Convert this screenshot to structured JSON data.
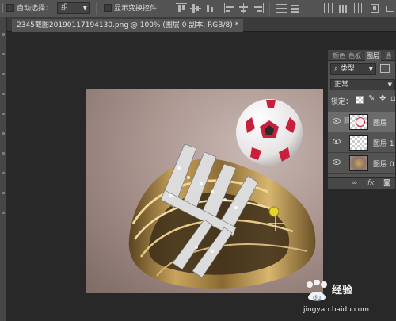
{
  "options_bar": {
    "auto_select_label": "自动选择：",
    "auto_select_value": "组",
    "show_transform_label": "显示变换控件"
  },
  "document": {
    "tab_title": "2345截图20190117194130.png @ 100% (图层 0 副本, RGB/8) *"
  },
  "layers_panel": {
    "tabs": [
      "颜色",
      "色板",
      "图层",
      "通"
    ],
    "active_tab": "图层",
    "filter_kind": "类型",
    "blend_mode": "正常",
    "lock_label": "锁定：",
    "layers": [
      {
        "name": "图层",
        "selected": true,
        "thumb": "ball"
      },
      {
        "name": "图层 1",
        "selected": false,
        "thumb": "empty"
      },
      {
        "name": "图层 0",
        "selected": false,
        "thumb": "ring"
      }
    ],
    "footer_icons": [
      "link-icon",
      "fx-icon",
      "mask-icon"
    ],
    "footer_fx": "fx."
  },
  "watermark": {
    "brand": "经验",
    "url": "jingyan.baidu.com"
  }
}
